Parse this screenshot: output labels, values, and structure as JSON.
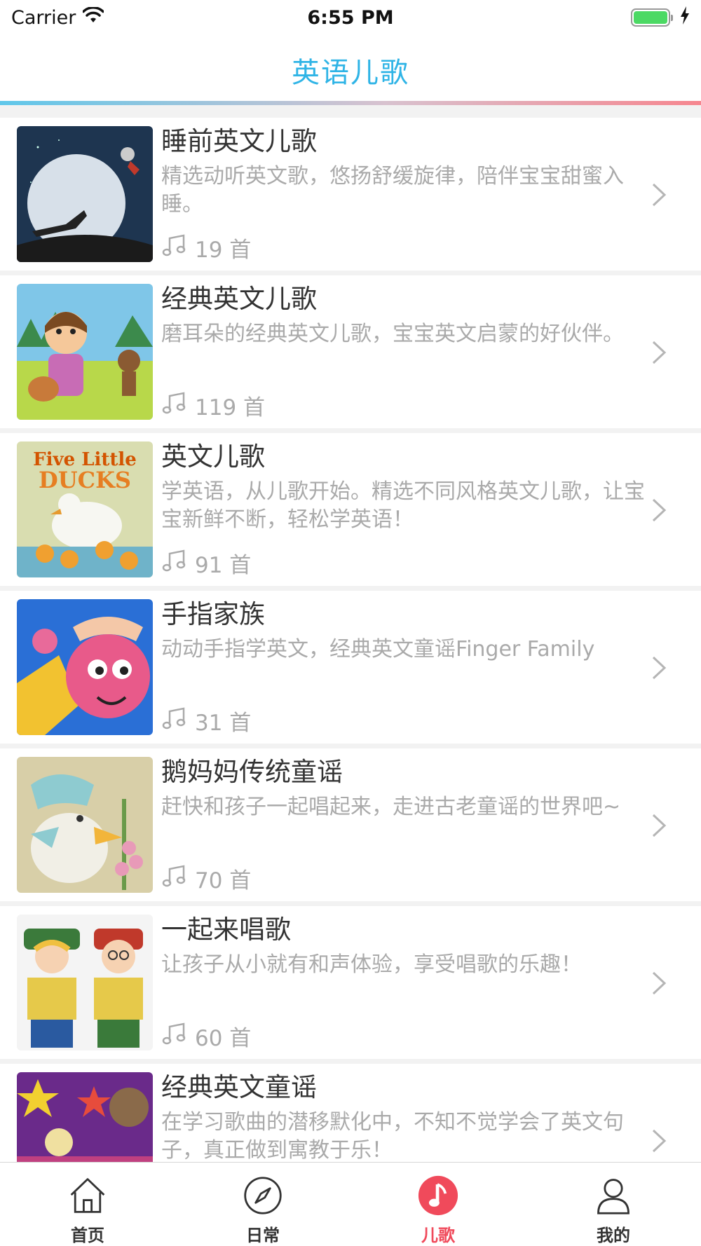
{
  "status": {
    "carrier": "Carrier",
    "time": "6:55 PM",
    "battery_level": 1.0
  },
  "nav": {
    "title": "英语儿歌"
  },
  "colors": {
    "accent": "#2fb4e6",
    "active_tab": "#f04a5b",
    "battery": "#4cd964"
  },
  "songlists": [
    {
      "title": "睡前英文儿歌",
      "description": "精选动听英文歌，悠扬舒缓旋律，陪伴宝宝甜蜜入睡。",
      "count": "19 首"
    },
    {
      "title": "经典英文儿歌",
      "description": "磨耳朵的经典英文儿歌，宝宝英文启蒙的好伙伴。",
      "count": "119 首"
    },
    {
      "title": "英文儿歌",
      "description": "学英语，从儿歌开始。精选不同风格英文儿歌，让宝宝新鲜不断，轻松学英语！",
      "count": "91 首",
      "thumb_text_1": "Five Little",
      "thumb_text_2": "DUCKS"
    },
    {
      "title": "手指家族",
      "description": "动动手指学英文，经典英文童谣Finger Family",
      "count": "31 首"
    },
    {
      "title": "鹅妈妈传统童谣",
      "description": "赶快和孩子一起唱起来，走进古老童谣的世界吧~",
      "count": "70 首"
    },
    {
      "title": "一起来唱歌",
      "description": "让孩子从小就有和声体验，享受唱歌的乐趣！",
      "count": "60 首"
    },
    {
      "title": "经典英文童谣",
      "description": "在学习歌曲的潜移默化中，不知不觉学会了英文句子，真正做到寓教于乐！",
      "count": ""
    }
  ],
  "tabs": [
    {
      "label": "首页",
      "icon": "home-icon"
    },
    {
      "label": "日常",
      "icon": "compass-icon"
    },
    {
      "label": "儿歌",
      "icon": "music-note-icon",
      "active": true
    },
    {
      "label": "我的",
      "icon": "person-icon"
    }
  ]
}
